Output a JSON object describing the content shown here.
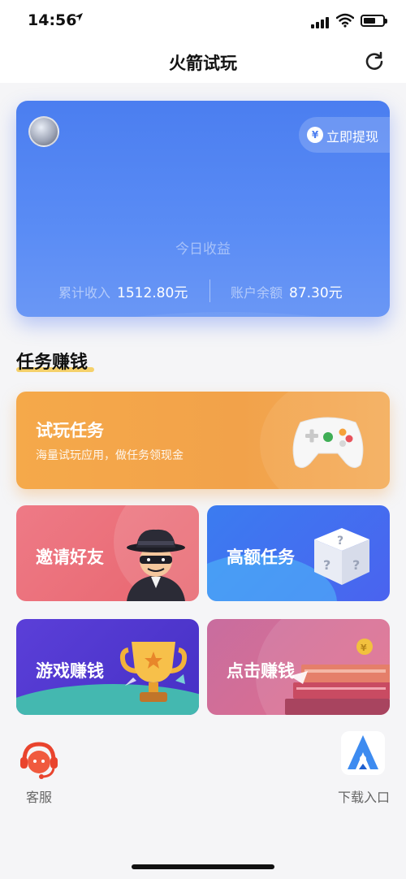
{
  "status_bar": {
    "time": "14:56"
  },
  "nav": {
    "title": "火箭试玩"
  },
  "earnings_card": {
    "withdraw_label": "立即提现",
    "today_label": "今日收益",
    "total_income_label": "累计收入",
    "total_income_value": "1512.80元",
    "balance_label": "账户余额",
    "balance_value": "87.30元"
  },
  "section": {
    "title": "任务赚钱"
  },
  "tasks": {
    "trial": {
      "title": "试玩任务",
      "subtitle": "海量试玩应用，做任务领现金"
    },
    "invite": {
      "title": "邀请好友"
    },
    "high": {
      "title": "高额任务"
    },
    "game": {
      "title": "游戏赚钱"
    },
    "click": {
      "title": "点击赚钱"
    }
  },
  "bottom": {
    "service_label": "客服",
    "download_label": "下载入口"
  },
  "icons": {
    "refresh": "refresh-icon",
    "yen": "yen-icon",
    "gamepad": "gamepad-icon",
    "spy": "spy-icon",
    "dice": "question-dice-icon",
    "trophy": "trophy-icon",
    "books": "books-icon",
    "headset": "headset-icon",
    "app_logo": "rocket-a-logo"
  },
  "colors": {
    "card_blue": "#4b7ef0",
    "trial_orange": "#f5a94a",
    "invite_pink": "#ee7a86",
    "high_blue": "#3b7cf0",
    "game_purple": "#5b3fd8",
    "click_pink": "#d96f92",
    "underline_yellow": "#f5d16b"
  }
}
